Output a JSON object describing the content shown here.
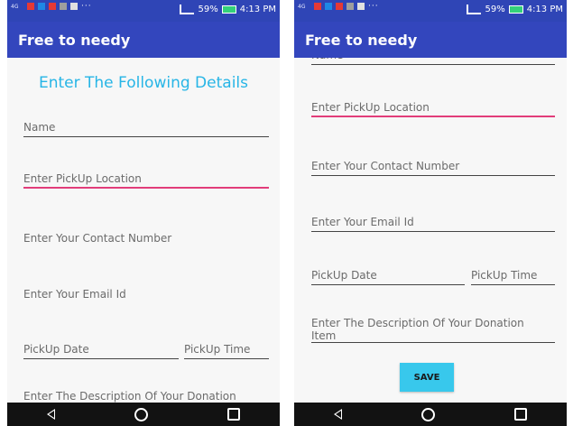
{
  "status_bar": {
    "time": "4:13 PM",
    "battery": "59%",
    "signal_text": "4G"
  },
  "app": {
    "title": "Free to needy"
  },
  "form": {
    "heading": "Enter The Following Details",
    "name_placeholder": "Name",
    "pickup_location_placeholder": "Enter PickUp Location",
    "contact_placeholder": "Enter Your Contact Number",
    "email_placeholder": "Enter Your Email Id",
    "pickup_date_placeholder": "PickUp Date",
    "pickup_time_placeholder": "PickUp Time",
    "description_placeholder": "Enter The Description Of Your Donation Item",
    "description_line1": "Enter The Description Of Your Donation",
    "description_line2": "Item",
    "save_label": "SAVE"
  },
  "colors": {
    "status_bar": "#2f45b6",
    "app_bar": "#3346bd",
    "heading": "#27b5e6",
    "focus_underline": "#e23d7a",
    "save_button": "#38c8ec"
  },
  "icons": [
    "back-icon",
    "home-icon",
    "recents-icon",
    "signal-icon",
    "battery-icon"
  ]
}
